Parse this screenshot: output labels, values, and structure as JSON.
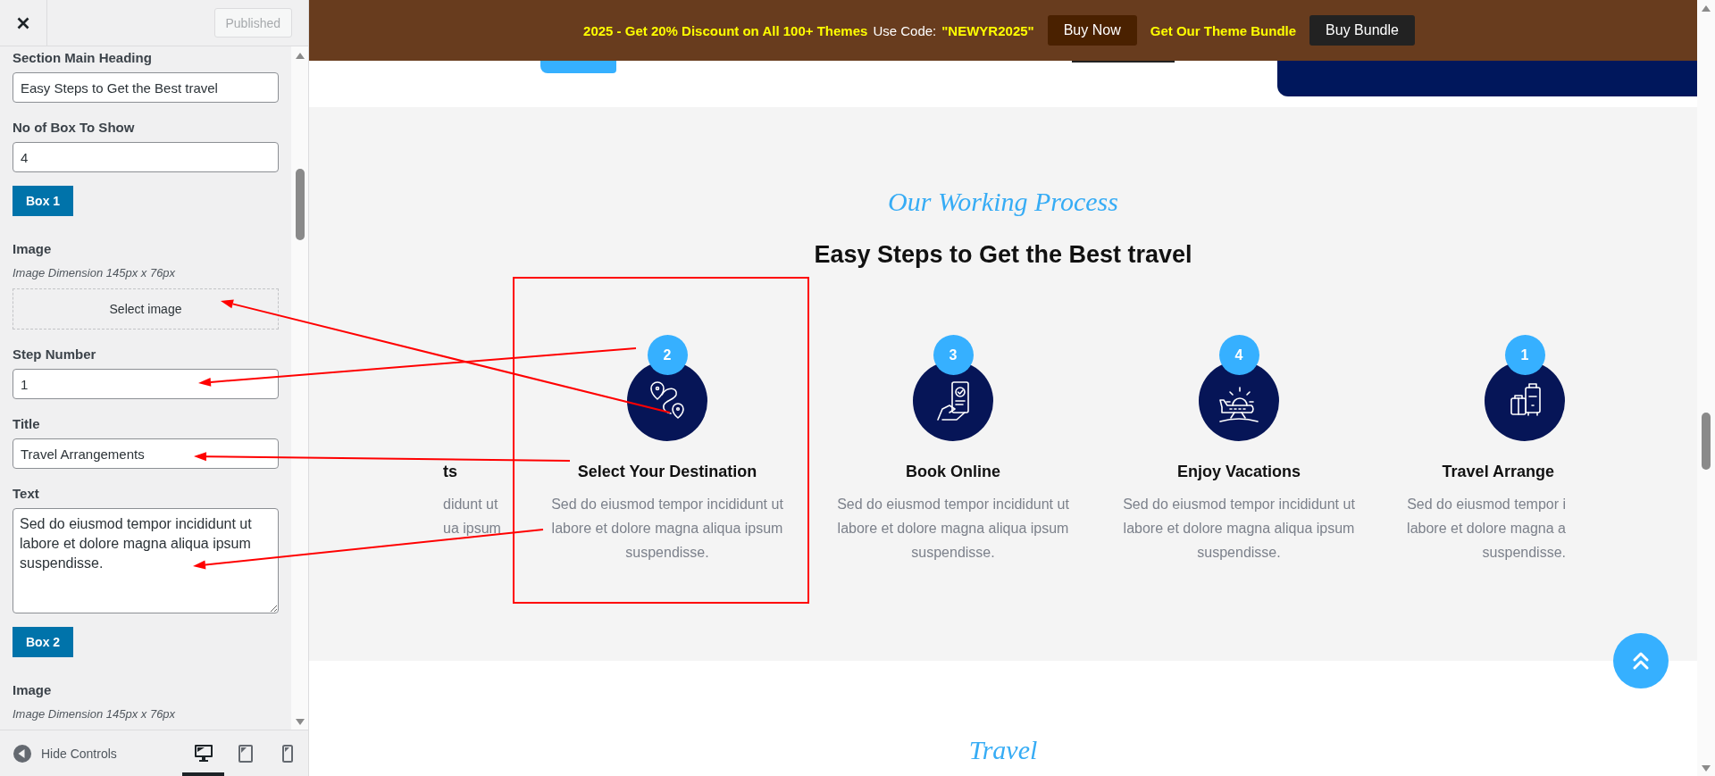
{
  "customizer": {
    "publish_button": {
      "label": "Published",
      "disabled": true
    },
    "controls": [
      {
        "kind": "input",
        "label": "Section Main Heading",
        "value": "Easy Steps to Get the Best travel"
      },
      {
        "kind": "input",
        "label": "No of Box To Show",
        "value": "4"
      },
      {
        "kind": "box",
        "label": "Box 1"
      },
      {
        "kind": "image",
        "label": "Image",
        "hint": "Image Dimension 145px x 76px",
        "button": "Select image"
      },
      {
        "kind": "input",
        "label": "Step Number",
        "value": "1"
      },
      {
        "kind": "input",
        "label": "Title",
        "value": "Travel Arrangements"
      },
      {
        "kind": "textarea",
        "label": "Text",
        "value": "Sed do eiusmod tempor incididunt ut labore et dolore magna aliqua ipsum suspendisse."
      },
      {
        "kind": "box",
        "label": "Box 2"
      },
      {
        "kind": "image",
        "label": "Image",
        "hint": "Image Dimension 145px x 76px"
      }
    ],
    "footer": {
      "hide_controls": "Hide Controls",
      "devices": [
        {
          "selected": true
        },
        {
          "selected": false
        },
        {
          "selected": false
        }
      ]
    }
  },
  "preview": {
    "promo_banner": [
      {
        "kind": "highlight",
        "text": "2025 - Get 20% Discount on All 100+ Themes"
      },
      {
        "kind": "plain",
        "text": "Use Code:"
      },
      {
        "kind": "highlight",
        "text": "\"NEWYR2025\""
      },
      {
        "kind": "button",
        "text": "Buy Now",
        "color": "#4a2100"
      },
      {
        "kind": "highlight",
        "text": "Get Our Theme Bundle"
      },
      {
        "kind": "button",
        "text": "Buy Bundle",
        "color": "#222222"
      }
    ],
    "process_section": {
      "eyebrow": "Our Working Process",
      "heading": "Easy Steps to Get the Best travel",
      "steps": [
        {
          "kind": "cut_left",
          "title": "ts",
          "lines": [
            "didunt ut",
            "ua ipsum"
          ]
        },
        {
          "kind": "full",
          "number": "2",
          "title": "Select Your Destination",
          "text": "Sed do eiusmod tempor incididunt ut labore et dolore magna aliqua ipsum suspendisse."
        },
        {
          "kind": "full",
          "number": "3",
          "title": "Book Online",
          "text": "Sed do eiusmod tempor incididunt ut labore et dolore magna aliqua ipsum suspendisse."
        },
        {
          "kind": "full",
          "number": "4",
          "title": "Enjoy Vacations",
          "text": "Sed do eiusmod tempor incididunt ut labore et dolore magna aliqua ipsum suspendisse."
        },
        {
          "kind": "cut_right",
          "number": "1",
          "title": "Travel Arrange",
          "lines": [
            "Sed do eiusmod tempor i",
            "labore et dolore magna a",
            "suspendisse."
          ]
        }
      ]
    },
    "next_section": {
      "eyebrow": "Travel"
    }
  }
}
